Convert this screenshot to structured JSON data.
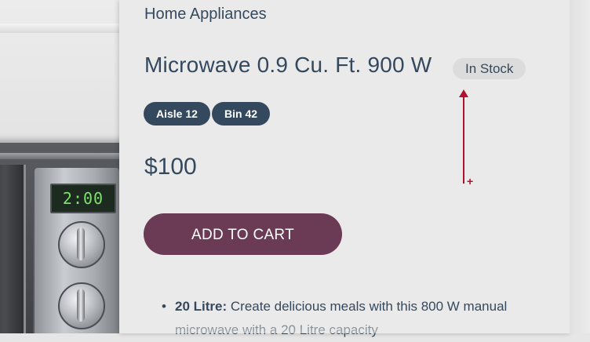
{
  "product": {
    "category": "Home Appliances",
    "title": "Microwave 0.9 Cu. Ft. 900 W",
    "stock_status": "In Stock",
    "tags": [
      "Aisle 12",
      "Bin 42"
    ],
    "price": "$100",
    "cart_button_label": "ADD TO CART",
    "features": [
      {
        "bullet": "•",
        "name": "20 Litre:",
        "description": "Create delicious meals with this 800 W manual microwave with a 20 Litre capacity"
      }
    ]
  },
  "image": {
    "display_time": "2:00",
    "alt": "microwave-product-image"
  },
  "colors": {
    "brand_text": "#34495e",
    "cart_button": "#6b3a54",
    "annotation": "#b0112e"
  },
  "icons": {
    "annotation_arrow": "arrow-up-icon",
    "cursor": "crosshair-icon"
  }
}
